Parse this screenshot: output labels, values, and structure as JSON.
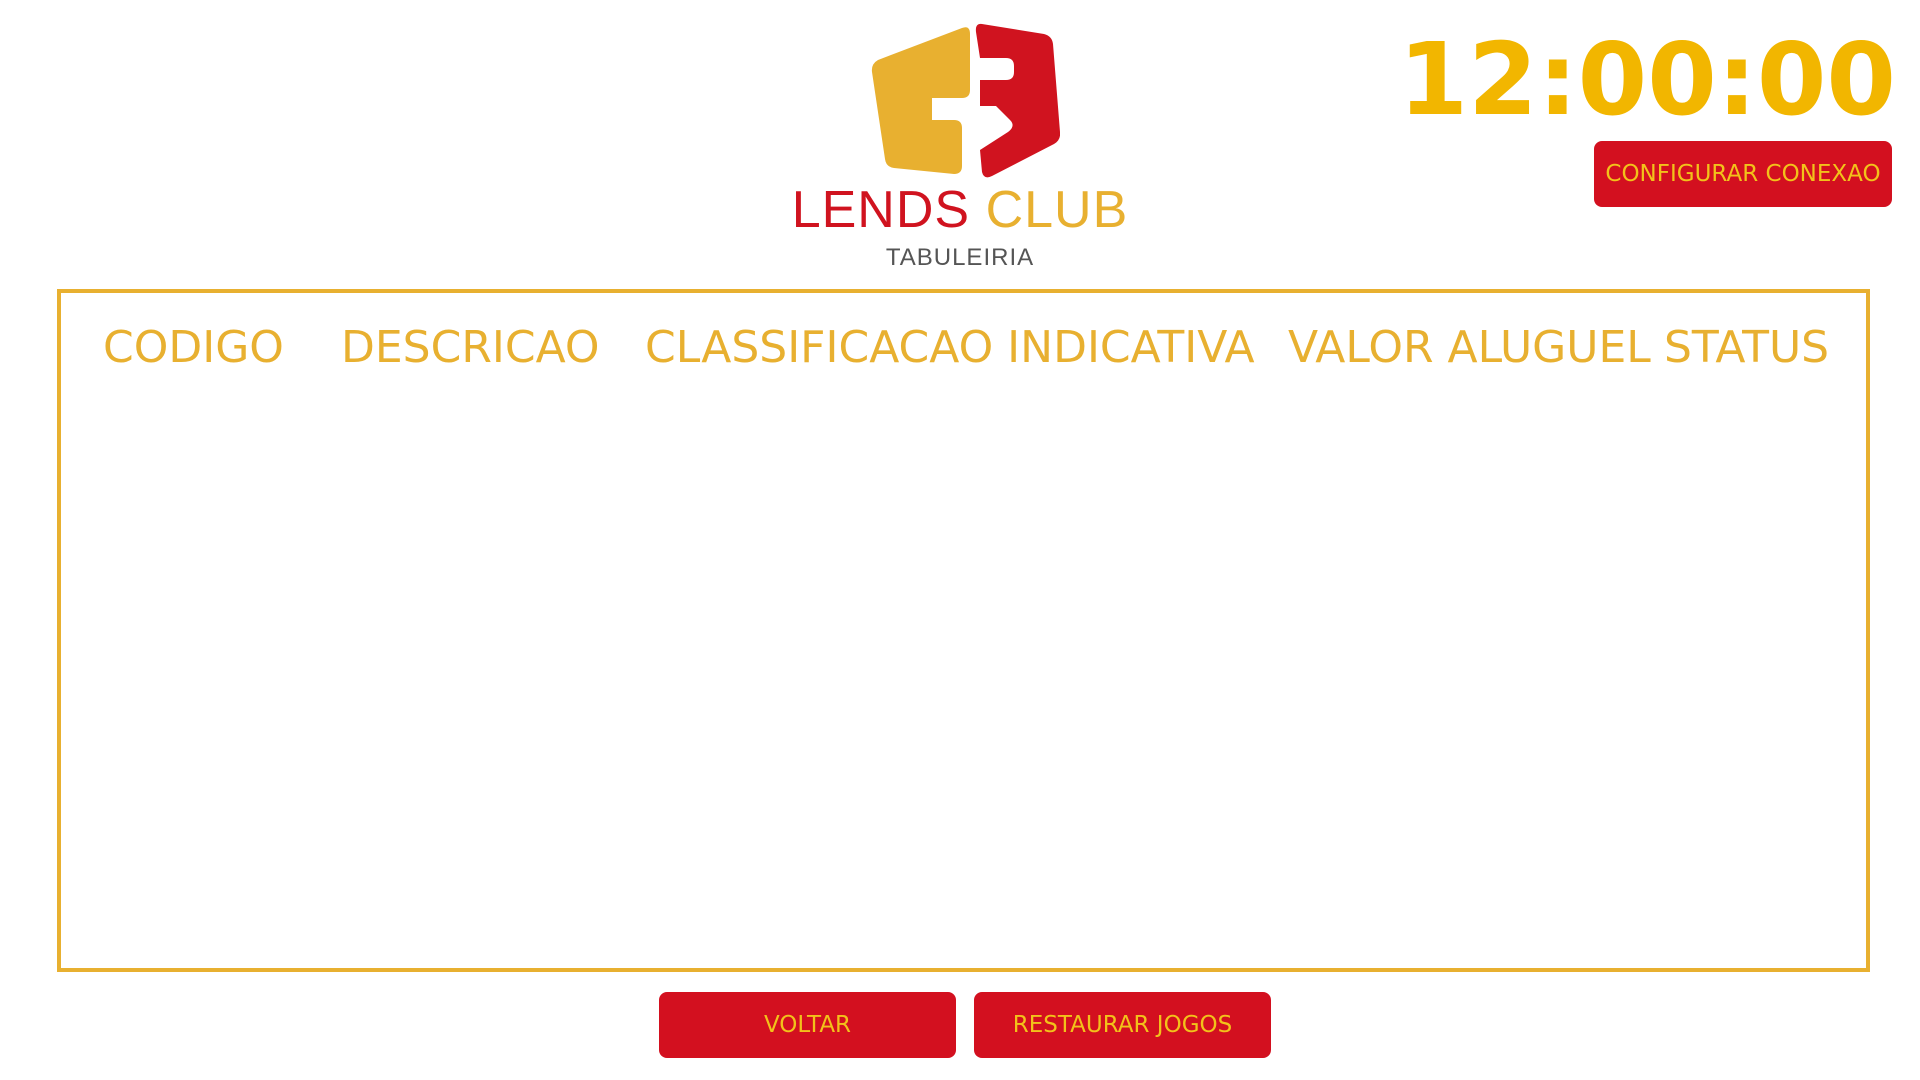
{
  "logo": {
    "title_word1": "LENDS",
    "title_word2": "CLUB",
    "subtitle": "TABULEIRIA",
    "colors": {
      "red": "#d0131f",
      "yellow": "#e8b030",
      "gray": "#555555"
    }
  },
  "clock": {
    "time": "12:00:00",
    "color": "#f2b600"
  },
  "header": {
    "config_button_label": "CONFIGURAR CONEXAO"
  },
  "table": {
    "columns": [
      "CODIGO",
      "DESCRICAO",
      "CLASSIFICACAO INDICATIVA",
      "VALOR ALUGUEL",
      "STATUS"
    ],
    "rows": [],
    "border_color": "#e8b030"
  },
  "footer": {
    "back_button_label": "VOLTAR",
    "restore_button_label": "RESTAURAR JOGOS"
  },
  "theme": {
    "button_bg": "#d3101f",
    "button_text": "#f2c21a"
  }
}
